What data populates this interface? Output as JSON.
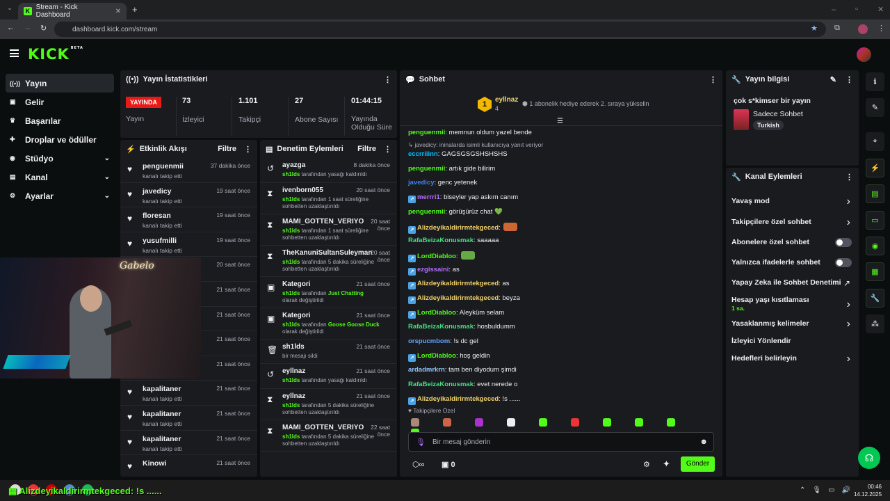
{
  "browser": {
    "tab_title": "Stream - Kick Dashboard",
    "url": "dashboard.kick.com/stream"
  },
  "brand": {
    "logo": "KICK",
    "beta": "BETA"
  },
  "sidebar": {
    "items": [
      {
        "label": "Yayın",
        "icon": "broadcast-icon"
      },
      {
        "label": "Gelir",
        "icon": "revenue-icon"
      },
      {
        "label": "Başarılar",
        "icon": "trophy-icon"
      },
      {
        "label": "Droplar ve ödüller",
        "icon": "gift-icon"
      },
      {
        "label": "Stüdyo",
        "icon": "studio-icon"
      },
      {
        "label": "Kanal",
        "icon": "channel-icon"
      },
      {
        "label": "Ayarlar",
        "icon": "settings-icon"
      }
    ]
  },
  "stats": {
    "title": "Yayın İstatistikleri",
    "live": "YAYINDA",
    "live_label": "Yayın",
    "viewers": "73",
    "viewers_label": "İzleyici",
    "followers": "1.101",
    "followers_label": "Takipçi",
    "subs": "27",
    "subs_label": "Abone Sayısı",
    "uptime": "01:44:15",
    "uptime_label1": "Yayında",
    "uptime_label2": "Olduğu Süre"
  },
  "activity": {
    "title": "Etkinlik Akışı",
    "filter": "Filtre",
    "items": [
      {
        "name": "penguenmii",
        "sub": "kanalı takip etti",
        "time": "37 dakika önce"
      },
      {
        "name": "javedicy",
        "sub": "kanalı takip etti",
        "time": "19 saat önce"
      },
      {
        "name": "floresan",
        "sub": "kanalı takip etti",
        "time": "19 saat önce"
      },
      {
        "name": "yusufmilli",
        "sub": "kanalı takip etti",
        "time": "19 saat önce"
      },
      {
        "name": "",
        "sub": "",
        "time": "20 saat önce"
      },
      {
        "name": "",
        "sub": "",
        "time": "21 saat önce"
      },
      {
        "name": "",
        "sub": "",
        "time": "21 saat önce"
      },
      {
        "name": "",
        "sub": "",
        "time": "21 saat önce"
      },
      {
        "name": "",
        "sub": "kanalı takip etti",
        "time": "21 saat önce"
      },
      {
        "name": "kapalitaner",
        "sub": "kanalı takip etti",
        "time": "21 saat önce"
      },
      {
        "name": "kapalitaner",
        "sub": "kanalı takip etti",
        "time": "21 saat önce"
      },
      {
        "name": "kapalitaner",
        "sub": "kanalı takip etti",
        "time": "21 saat önce"
      },
      {
        "name": "Kinowi",
        "sub": "",
        "time": "21 saat önce"
      }
    ]
  },
  "moderation": {
    "title": "Denetim Eylemleri",
    "filter": "Filtre",
    "items": [
      {
        "icon": "unban-icon",
        "name": "ayazga",
        "by": "sh1lds",
        "text": " tarafından yasağı kaldırıldı",
        "time": "8 dakika önce"
      },
      {
        "icon": "timeout-icon",
        "name": "ivenborn055",
        "by": "sh1lds",
        "text": " tarafından 1 saat süreliğine sohbetten uzaklaştırıldı",
        "time": "20 saat önce"
      },
      {
        "icon": "timeout-icon",
        "name": "MAMI_GOTTEN_VERIYO",
        "by": "sh1lds",
        "text": " tarafından 1 saat süreliğine sohbetten uzaklaştırıldı",
        "time": "20 saat önce"
      },
      {
        "icon": "timeout-icon",
        "name": "TheKanuniSultanSuleyman",
        "by": "sh1lds",
        "text": " tarafından 5 dakika süreliğine sohbetten uzaklaştırıldı",
        "time": "20 saat önce"
      },
      {
        "icon": "category-icon",
        "name": "Kategori",
        "by": "sh1lds",
        "text": " tarafından ",
        "hl": "Just Chatting",
        "text2": " olarak değiştirildi",
        "time": "21 saat önce"
      },
      {
        "icon": "category-icon",
        "name": "Kategori",
        "by": "sh1lds",
        "text": " tarafından ",
        "hl": "Goose Goose Duck",
        "text2": " olarak değiştirildi",
        "time": "21 saat önce"
      },
      {
        "icon": "trash-icon",
        "name": "sh1lds",
        "by": "",
        "text": "bir mesajı sildi",
        "time": "21 saat önce"
      },
      {
        "icon": "unban-icon",
        "name": "eyllnaz",
        "by": "sh1lds",
        "text": " tarafından yasağı kaldırıldı",
        "time": "21 saat önce"
      },
      {
        "icon": "timeout-icon",
        "name": "eyllnaz",
        "by": "sh1lds",
        "text": " tarafından 5 dakika süreliğine sohbetten uzaklaştırıldı",
        "time": "21 saat önce"
      },
      {
        "icon": "timeout-icon",
        "name": "MAMI_GOTTEN_VERIYO",
        "by": "sh1lds",
        "text": " tarafından 5 dakika süreliğine sohbetten uzaklaştırıldı",
        "time": "22 saat önce"
      }
    ]
  },
  "chat": {
    "title": "Sohbet",
    "pinned_user": "eyllnaz",
    "pinned_rank": "1",
    "pinned_count": "4",
    "pinned_text": "1 abonelik hediye ederek 2. sıraya yükselin",
    "messages": [
      {
        "user": "penguenmii",
        "color": "#53fc18",
        "text": ": memnun oldum yazel bende"
      },
      {
        "user": "",
        "color": "#adadb8",
        "text": "↳ javedicy: ininalarda isimli kullanıcıya yanıt veriyor",
        "reply": true
      },
      {
        "user": "eccrriiinn",
        "color": "#00bfff",
        "text": ": GAGSGSGSHSHSHS"
      },
      {
        "user": "penguenmii",
        "color": "#53fc18",
        "text": ": artık gide bilirim"
      },
      {
        "user": "javedicy",
        "color": "#3b82f6",
        "text": ": genc yetenek"
      },
      {
        "user": "merrri1",
        "color": "#b66dff",
        "text": ": biseyler yap askım canım"
      },
      {
        "user": "penguenmii",
        "color": "#53fc18",
        "text": ": görüşürüz chat 💚"
      },
      {
        "user": "Alizdeyikaldirirmtekgeced",
        "color": "#f5d46a",
        "text": ":"
      },
      {
        "user": "RafaBeizaKonusmak",
        "color": "#4ade80",
        "text": ": saaaaa"
      },
      {
        "user": "LordDiabloo",
        "color": "#53fc18",
        "text": ":"
      },
      {
        "user": "ezgissaini",
        "color": "#b66dff",
        "text": ": as"
      },
      {
        "user": "Alizdeyikaldirirmtekgeced",
        "color": "#f5d46a",
        "text": ": as"
      },
      {
        "user": "Alizdeyikaldirirmtekgeced",
        "color": "#f5d46a",
        "text": ": beyza"
      },
      {
        "user": "LordDiabloo",
        "color": "#53fc18",
        "text": ": Aleyküm selam"
      },
      {
        "user": "RafaBeizaKonusmak",
        "color": "#4ade80",
        "text": ": hosbuldumm"
      },
      {
        "user": "orspucmbom",
        "color": "#60a5fa",
        "text": ": !s dc gel"
      },
      {
        "user": "LordDiabloo",
        "color": "#53fc18",
        "text": ": hoş geldin"
      },
      {
        "user": "ardadmrkrn",
        "color": "#93c5fd",
        "text": ": tam ben diyodum şimdi"
      },
      {
        "user": "RafaBeizaKonusmak",
        "color": "#4ade80",
        "text": ": evet nerede o"
      },
      {
        "user": "Alizdeyikaldirirmtekgeced",
        "color": "#f5d46a",
        "text": ": !s ......"
      }
    ],
    "follower_only": "Takipçilere Özel",
    "placeholder": "Bir mesaj gönderin",
    "points": "0",
    "send": "Gönder"
  },
  "info": {
    "title": "Yayın bilgisi",
    "stream_title": "çok s*kimser bir yayın",
    "category": "Sadece Sohbet",
    "tag": "Turkish"
  },
  "actions": {
    "title": "Kanal Eylemleri",
    "items": [
      {
        "label": "Yavaş mod",
        "type": "chev"
      },
      {
        "label": "Takipçilere özel sohbet",
        "type": "chev"
      },
      {
        "label": "Abonelere özel sohbet",
        "type": "toggle"
      },
      {
        "label": "Yalnızca ifadelerle sohbet",
        "type": "toggle"
      },
      {
        "label": "Yapay Zeka ile Sohbet Denetimi",
        "type": "ext"
      },
      {
        "label": "Hesap yaşı kısıtlaması",
        "sub": "1 sa.",
        "type": "chev"
      },
      {
        "label": "Yasaklanmış kelimeler",
        "type": "chev"
      },
      {
        "label": "İzleyici Yönlendir",
        "type": "none"
      },
      {
        "label": "Hedefleri belirleyin",
        "type": "chev"
      }
    ]
  },
  "overlay": {
    "text": "Alizdeyikaldirirmtekgeced: !s ......"
  },
  "webcam": {
    "sign": "Gabelo"
  },
  "clock": {
    "time": "00:46",
    "date": "14.12.2025"
  }
}
